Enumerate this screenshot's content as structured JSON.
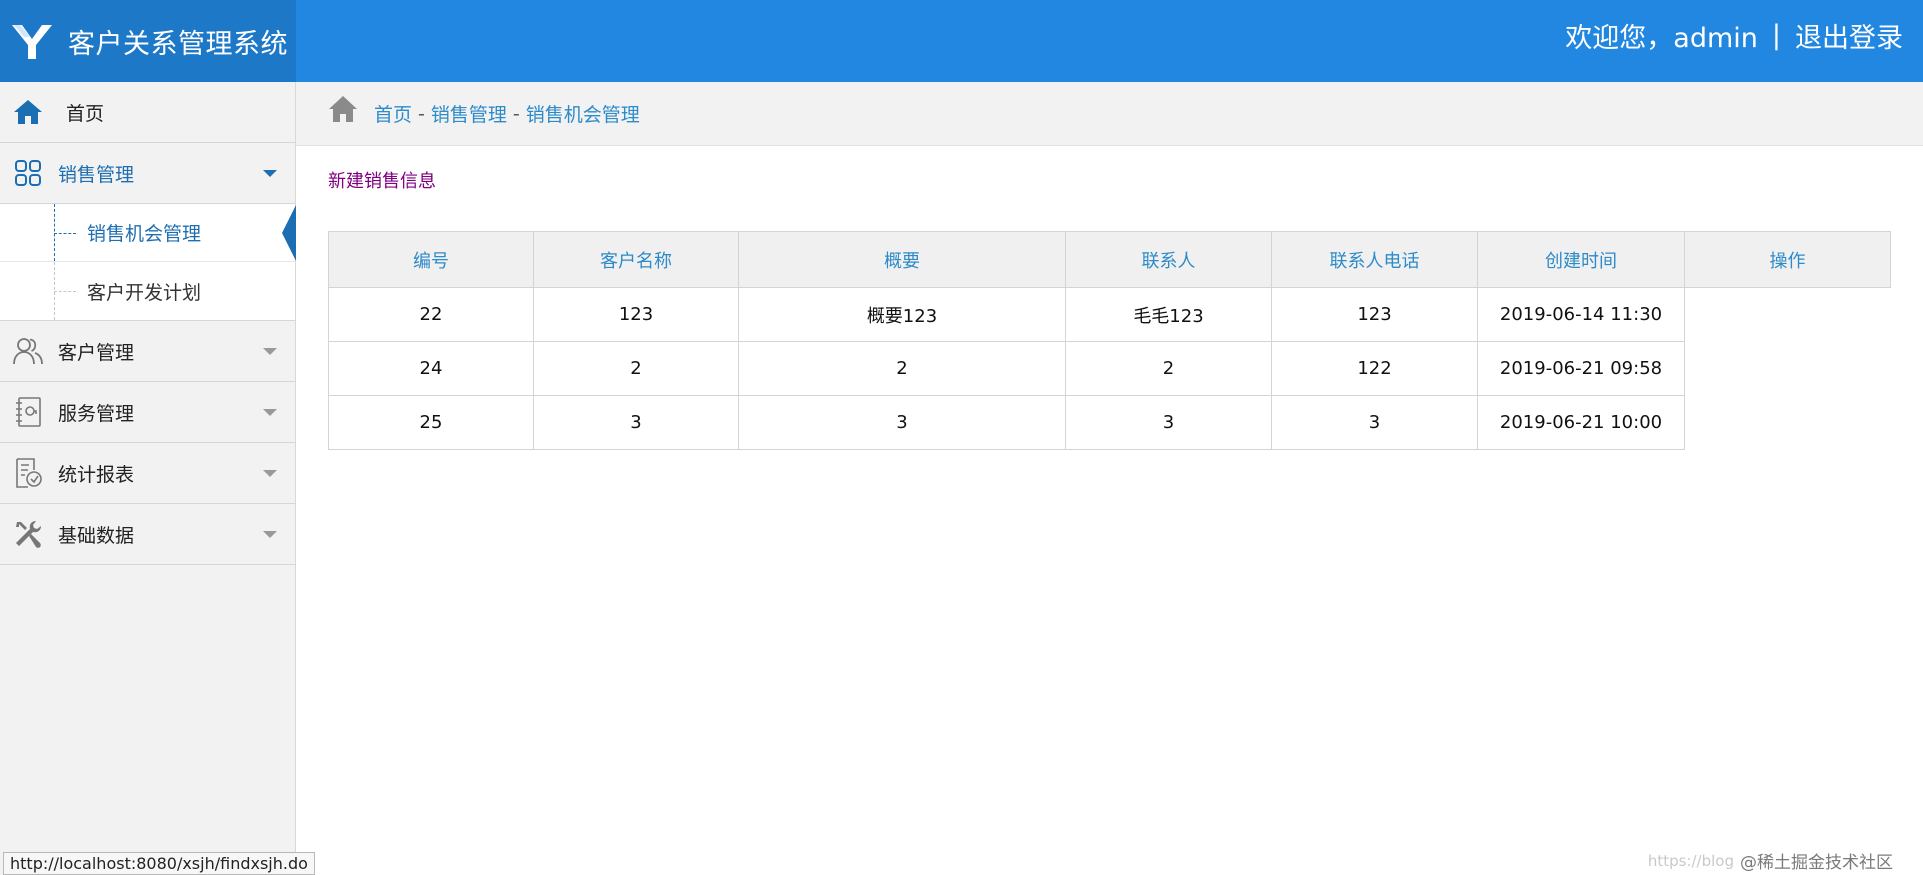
{
  "header": {
    "app_title": "客户关系管理系统",
    "welcome_text": "欢迎您，admin",
    "separator": "|",
    "logout_label": "退出登录",
    "brand_color": "#1e78c8",
    "bar_color": "#2287e0"
  },
  "sidebar": {
    "home": {
      "label": "首页",
      "icon": "home-icon"
    },
    "sales": {
      "label": "销售管理",
      "icon": "grid-icon",
      "expanded": true,
      "children": [
        {
          "label": "销售机会管理",
          "active": true
        },
        {
          "label": "客户开发计划",
          "active": false
        }
      ]
    },
    "customer": {
      "label": "客户管理",
      "icon": "users-icon"
    },
    "service": {
      "label": "服务管理",
      "icon": "notebook-icon"
    },
    "reports": {
      "label": "统计报表",
      "icon": "report-icon"
    },
    "basedata": {
      "label": "基础数据",
      "icon": "tools-icon"
    }
  },
  "breadcrumb": {
    "items": [
      "首页",
      "销售管理",
      "销售机会管理"
    ],
    "separator": "-"
  },
  "main": {
    "new_link": "新建销售信息"
  },
  "table": {
    "headers": [
      "编号",
      "客户名称",
      "概要",
      "联系人",
      "联系人电话",
      "创建时间",
      "操作"
    ],
    "rows": [
      [
        "22",
        "123",
        "概要123",
        "毛毛123",
        "123",
        "2019-06-14 11:30",
        ""
      ],
      [
        "24",
        "2",
        "2",
        "2",
        "122",
        "2019-06-21 09:58",
        ""
      ],
      [
        "25",
        "3",
        "3",
        "3",
        "3",
        "2019-06-21 10:00",
        ""
      ]
    ]
  },
  "statusbar": {
    "url": "http://localhost:8080/xsjh/findxsjh.do"
  },
  "watermark": {
    "url": "https://blog",
    "text": "@稀土掘金技术社区"
  }
}
